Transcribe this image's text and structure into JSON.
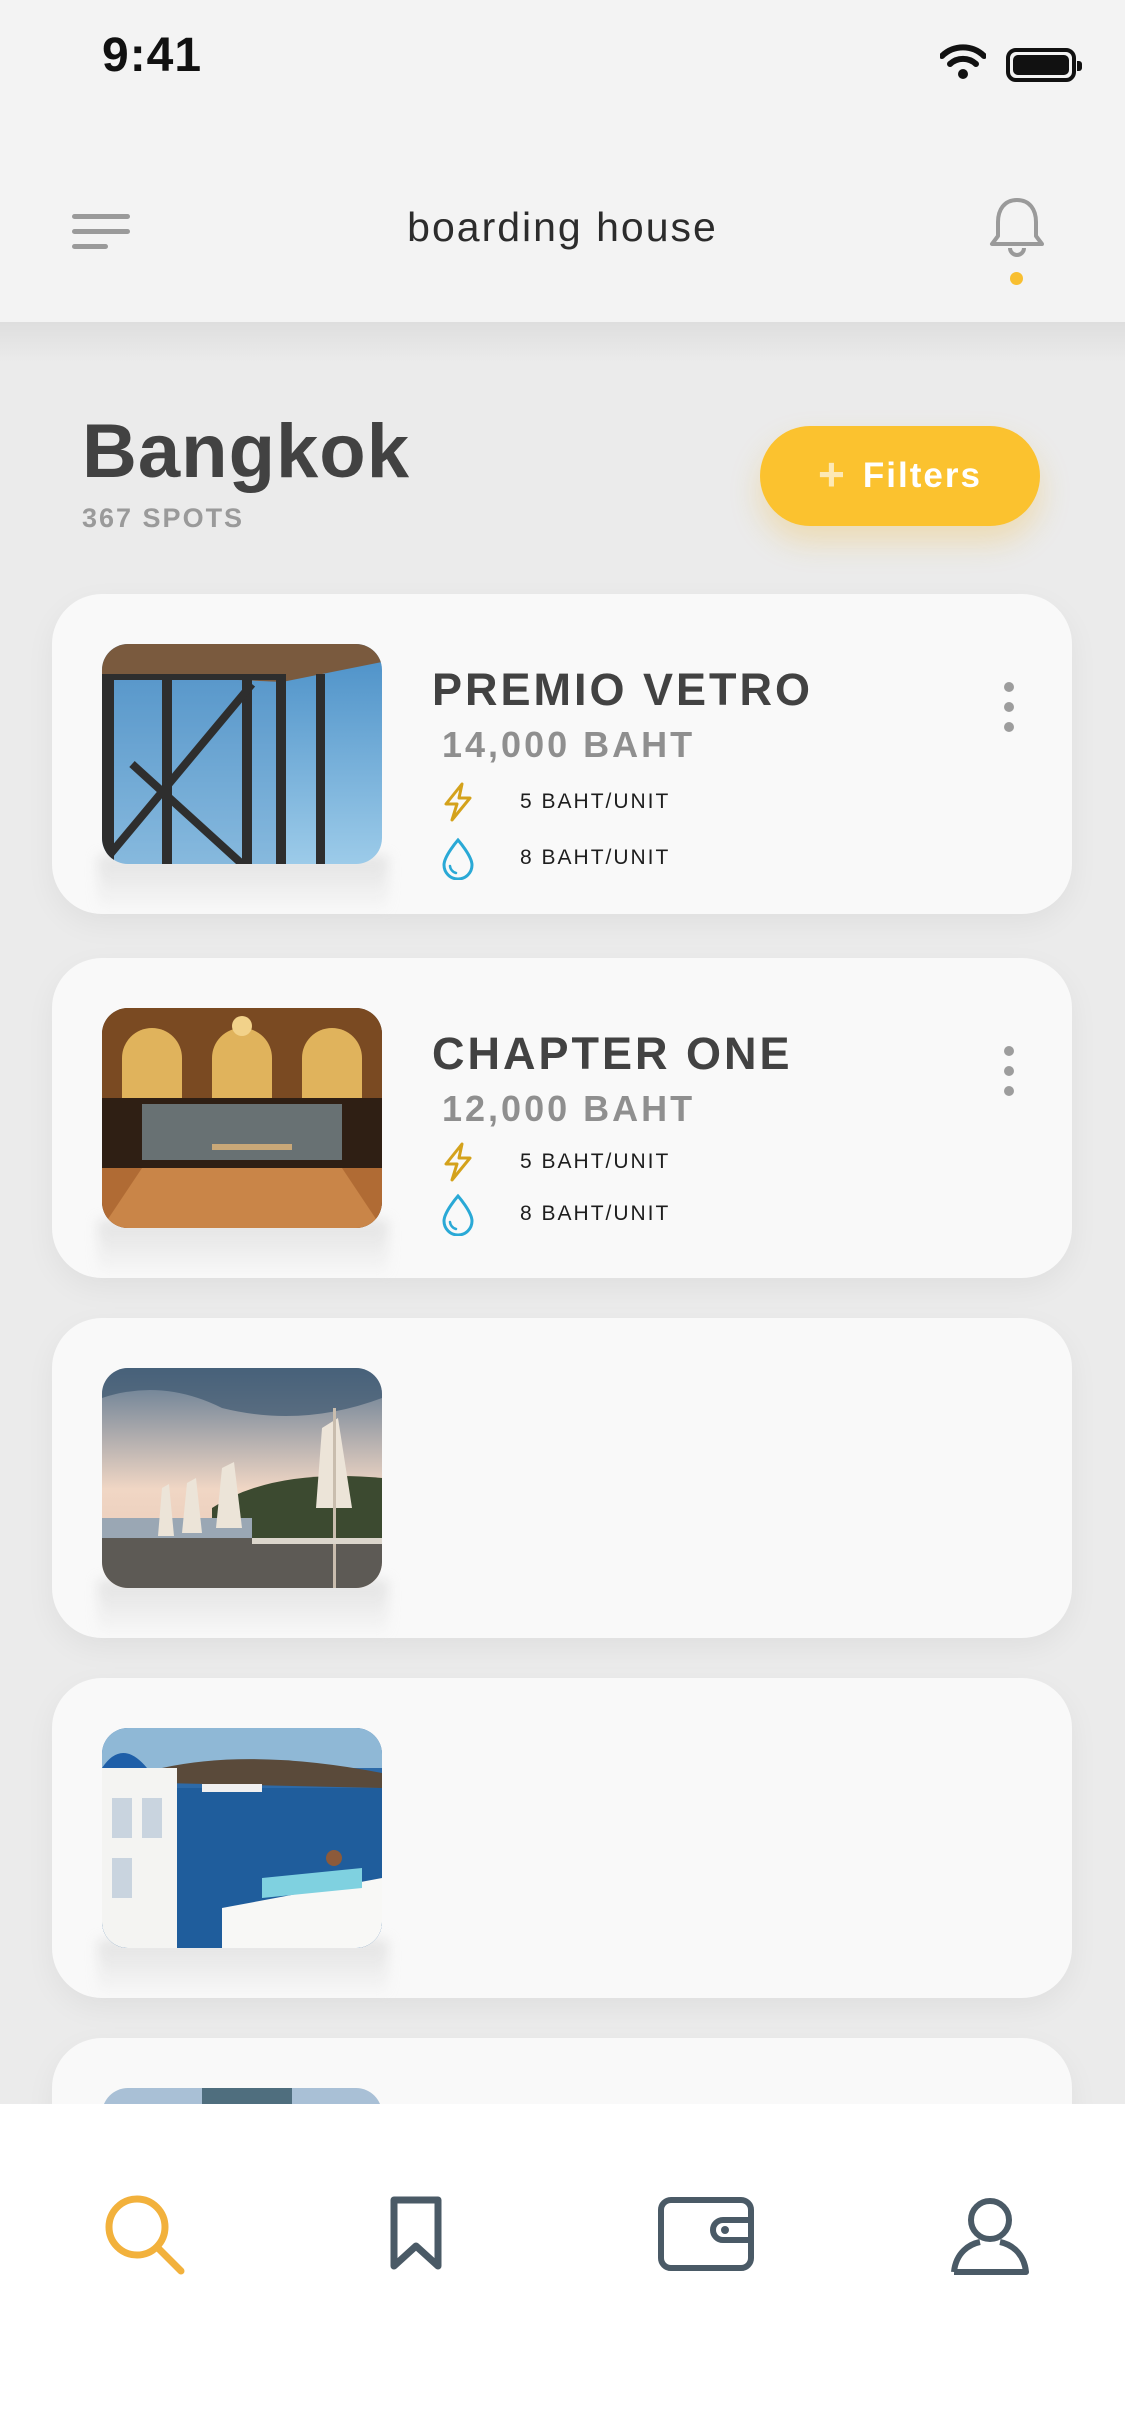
{
  "status_bar": {
    "time": "9:41"
  },
  "header": {
    "title": "boarding house",
    "menu_icon": "menu-icon",
    "notification_icon": "bell-icon"
  },
  "location": {
    "city": "Bangkok",
    "count": "367 SPOTS"
  },
  "filters": {
    "plus": "+",
    "label": "Filters"
  },
  "listings": [
    {
      "name": "PREMIO VETRO",
      "price": "14,000 BAHT",
      "electricity": "5 BAHT/UNIT",
      "water": "8 BAHT/UNIT"
    },
    {
      "name": "CHAPTER ONE",
      "price": "12,000 BAHT",
      "electricity": "5 BAHT/UNIT",
      "water": "8 BAHT/UNIT"
    },
    {
      "name": "",
      "price": ""
    },
    {
      "name": "",
      "price": ""
    }
  ],
  "bottom_nav": [
    {
      "icon": "search-icon",
      "active": true
    },
    {
      "icon": "bookmark-icon",
      "active": false
    },
    {
      "icon": "wallet-icon",
      "active": false
    },
    {
      "icon": "profile-icon",
      "active": false
    }
  ],
  "colors": {
    "accent": "#fbc22f",
    "electric": "#d4a21c",
    "water": "#2aa9d6",
    "nav_inactive": "#4a5a66",
    "nav_active": "#f2b13c"
  }
}
